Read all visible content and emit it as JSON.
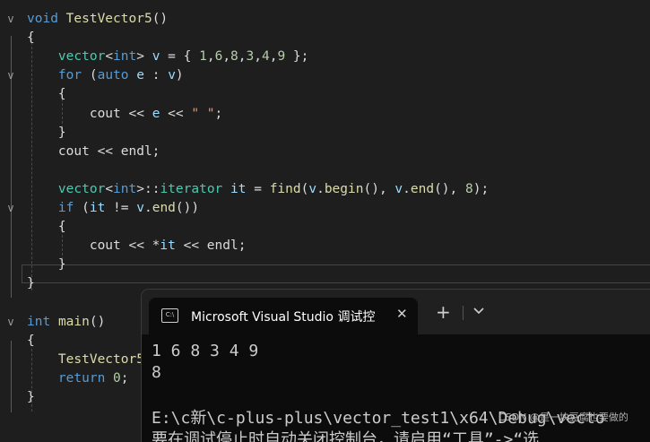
{
  "editor": {
    "lines": [
      {
        "parts": [
          {
            "t": "void",
            "c": "kw"
          },
          {
            "t": " "
          },
          {
            "t": "TestVector5",
            "c": "fn"
          },
          {
            "t": "()"
          }
        ]
      },
      {
        "parts": [
          {
            "t": "{"
          }
        ]
      },
      {
        "parts": [
          {
            "t": "    "
          },
          {
            "t": "vector",
            "c": "ty"
          },
          {
            "t": "<"
          },
          {
            "t": "int",
            "c": "kw"
          },
          {
            "t": "> "
          },
          {
            "t": "v",
            "c": "var"
          },
          {
            "t": " = { "
          },
          {
            "t": "1",
            "c": "num"
          },
          {
            "t": ","
          },
          {
            "t": "6",
            "c": "num"
          },
          {
            "t": ","
          },
          {
            "t": "8",
            "c": "num"
          },
          {
            "t": ","
          },
          {
            "t": "3",
            "c": "num"
          },
          {
            "t": ","
          },
          {
            "t": "4",
            "c": "num"
          },
          {
            "t": ","
          },
          {
            "t": "9",
            "c": "num"
          },
          {
            "t": " };"
          }
        ]
      },
      {
        "parts": [
          {
            "t": "    "
          },
          {
            "t": "for",
            "c": "kw"
          },
          {
            "t": " ("
          },
          {
            "t": "auto",
            "c": "kw"
          },
          {
            "t": " "
          },
          {
            "t": "e",
            "c": "var"
          },
          {
            "t": " : "
          },
          {
            "t": "v",
            "c": "var"
          },
          {
            "t": ")"
          }
        ]
      },
      {
        "parts": [
          {
            "t": "    {"
          }
        ]
      },
      {
        "parts": [
          {
            "t": "        cout << "
          },
          {
            "t": "e",
            "c": "var"
          },
          {
            "t": " << "
          },
          {
            "t": "\" \"",
            "c": "str"
          },
          {
            "t": ";"
          }
        ]
      },
      {
        "parts": [
          {
            "t": "    }"
          }
        ]
      },
      {
        "parts": [
          {
            "t": "    cout << endl;"
          }
        ]
      },
      {
        "parts": [
          {
            "t": ""
          }
        ]
      },
      {
        "parts": [
          {
            "t": "    "
          },
          {
            "t": "vector",
            "c": "ty"
          },
          {
            "t": "<"
          },
          {
            "t": "int",
            "c": "kw"
          },
          {
            "t": ">::"
          },
          {
            "t": "iterator",
            "c": "ty"
          },
          {
            "t": " "
          },
          {
            "t": "it",
            "c": "var"
          },
          {
            "t": " = "
          },
          {
            "t": "find",
            "c": "fn"
          },
          {
            "t": "("
          },
          {
            "t": "v",
            "c": "var"
          },
          {
            "t": "."
          },
          {
            "t": "begin",
            "c": "fn"
          },
          {
            "t": "(), "
          },
          {
            "t": "v",
            "c": "var"
          },
          {
            "t": "."
          },
          {
            "t": "end",
            "c": "fn"
          },
          {
            "t": "(), "
          },
          {
            "t": "8",
            "c": "num"
          },
          {
            "t": ");"
          }
        ]
      },
      {
        "parts": [
          {
            "t": "    "
          },
          {
            "t": "if",
            "c": "kw"
          },
          {
            "t": " ("
          },
          {
            "t": "it",
            "c": "var"
          },
          {
            "t": " != "
          },
          {
            "t": "v",
            "c": "var"
          },
          {
            "t": "."
          },
          {
            "t": "end",
            "c": "fn"
          },
          {
            "t": "())"
          }
        ]
      },
      {
        "parts": [
          {
            "t": "    {"
          }
        ]
      },
      {
        "parts": [
          {
            "t": "        cout << *"
          },
          {
            "t": "it",
            "c": "var"
          },
          {
            "t": " << endl;"
          }
        ]
      },
      {
        "parts": [
          {
            "t": "    }"
          }
        ]
      },
      {
        "parts": [
          {
            "t": "}"
          }
        ]
      },
      {
        "parts": [
          {
            "t": ""
          }
        ]
      },
      {
        "parts": [
          {
            "t": "int",
            "c": "kw"
          },
          {
            "t": " "
          },
          {
            "t": "main",
            "c": "fn"
          },
          {
            "t": "()"
          }
        ]
      },
      {
        "parts": [
          {
            "t": "{"
          }
        ]
      },
      {
        "parts": [
          {
            "t": "    "
          },
          {
            "t": "TestVector5",
            "c": "fn"
          }
        ]
      },
      {
        "parts": [
          {
            "t": "    "
          },
          {
            "t": "return",
            "c": "kw"
          },
          {
            "t": " "
          },
          {
            "t": "0",
            "c": "num"
          },
          {
            "t": ";"
          }
        ]
      },
      {
        "parts": [
          {
            "t": "}"
          }
        ]
      }
    ],
    "fold_markers": [
      "v",
      "",
      "",
      "v",
      "",
      "",
      "",
      "",
      "",
      "",
      "v",
      "",
      "",
      "",
      "",
      "",
      "v",
      "",
      "",
      "",
      ""
    ]
  },
  "terminal": {
    "tab_title": "Microsoft Visual Studio 调试控",
    "tab_icon_text": "C:\\",
    "close_glyph": "✕",
    "new_tab_glyph": "+",
    "output": [
      "1 6 8 3 4 9",
      "8",
      "",
      "E:\\c新\\c-plus-plus\\vector_test1\\x64\\Debug\\vecto",
      "要在调试停止时自动关闭控制台，请启用“工具”->“选"
    ]
  },
  "watermark": "CSDN @是一块豆腐也要做的"
}
